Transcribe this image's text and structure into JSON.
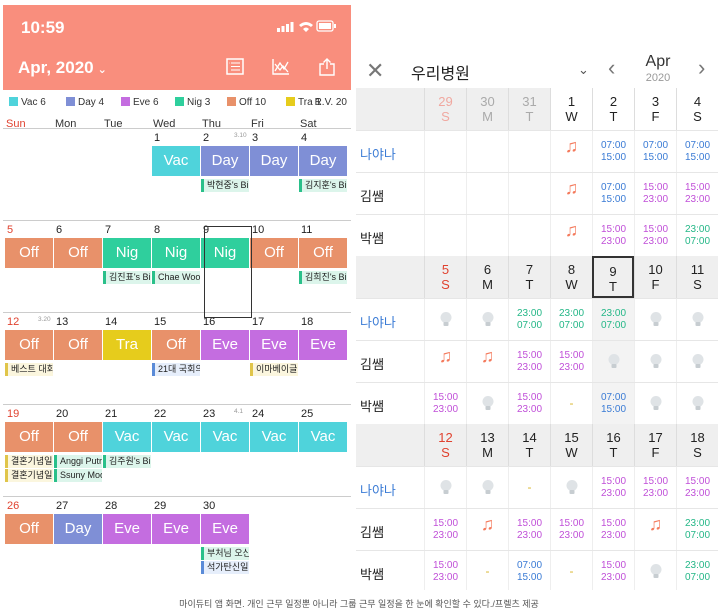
{
  "caption": "마이듀티 앱 화면. 개인 근무 일정뿐 아니라 그룹 근무 일정을 한 눈에 확인할 수 있다./프렐츠 제공",
  "colors": {
    "Vac": "#4fd3db",
    "Day": "#7f8fd6",
    "Eve": "#c46de0",
    "Nig": "#2fcf9d",
    "Off": "#e8916a",
    "Tra": "#e6cc1c",
    "header": "#f98e7d"
  },
  "left": {
    "status_time": "10:59",
    "status_icons": "●●●● ◢ ▭",
    "month_label": "Apr, 2020",
    "icons": [
      "list-icon",
      "chart-icon",
      "share-icon"
    ],
    "legend": [
      {
        "label": "Vac 6",
        "key": "Vac"
      },
      {
        "label": "Day 4",
        "key": "Day"
      },
      {
        "label": "Eve 6",
        "key": "Eve"
      },
      {
        "label": "Nig 3",
        "key": "Nig"
      },
      {
        "label": "Off 10",
        "key": "Off"
      },
      {
        "label": "Tra 1",
        "key": "Tra"
      }
    ],
    "version": "R.V. 20",
    "dows": [
      "Sun",
      "Mon",
      "Tue",
      "Wed",
      "Thu",
      "Fri",
      "Sat"
    ],
    "weeks": [
      {
        "days": [
          "",
          "",
          "",
          "1",
          "2",
          "3",
          "4"
        ],
        "shifts": [
          "",
          "",
          "",
          "Vac",
          "Day",
          "Day",
          "Day"
        ],
        "sub": {
          "4": "3.10"
        }
      },
      {
        "days": [
          "5",
          "6",
          "7",
          "8",
          "9",
          "10",
          "11"
        ],
        "shifts": [
          "Off",
          "Off",
          "Nig",
          "Nig",
          "Nig",
          "Off",
          "Off"
        ],
        "sub": {}
      },
      {
        "days": [
          "12",
          "13",
          "14",
          "15",
          "16",
          "17",
          "18"
        ],
        "shifts": [
          "Off",
          "Off",
          "Tra",
          "Off",
          "Eve",
          "Eve",
          "Eve"
        ],
        "sub": {
          "0": "3.20"
        }
      },
      {
        "days": [
          "19",
          "20",
          "21",
          "22",
          "23",
          "24",
          "25"
        ],
        "shifts": [
          "Off",
          "Off",
          "Vac",
          "Vac",
          "Vac",
          "Vac",
          "Vac"
        ],
        "sub": {
          "4": "4.1"
        }
      },
      {
        "days": [
          "26",
          "27",
          "28",
          "29",
          "30",
          "",
          ""
        ],
        "shifts": [
          "Off",
          "Day",
          "Eve",
          "Eve",
          "Eve",
          "",
          ""
        ],
        "sub": {}
      }
    ],
    "memos": [
      {
        "week": 0,
        "col": 4,
        "text": "박현중's Bir",
        "cls": "g"
      },
      {
        "week": 0,
        "col": 6,
        "text": "김지훈's Bir",
        "cls": "g"
      },
      {
        "week": 1,
        "col": 2,
        "text": "김진표's Bir",
        "cls": "g"
      },
      {
        "week": 1,
        "col": 3,
        "text": "Chae Woo",
        "cls": "g"
      },
      {
        "week": 1,
        "col": 6,
        "text": "김희진's Bir",
        "cls": "g"
      },
      {
        "week": 2,
        "col": 0,
        "text": "베스트 대회",
        "cls": "y"
      },
      {
        "week": 2,
        "col": 3,
        "text": "21대 국회의원",
        "cls": "b"
      },
      {
        "week": 2,
        "col": 5,
        "text": "이마베이글",
        "cls": "y"
      },
      {
        "week": 3,
        "col": 0,
        "text": "결혼기념일",
        "cls": "y"
      },
      {
        "week": 3,
        "col": 0,
        "text": "결혼기념일",
        "cls": "y",
        "line": 1
      },
      {
        "week": 3,
        "col": 1,
        "text": "Anggi Putri",
        "cls": "g"
      },
      {
        "week": 3,
        "col": 1,
        "text": "Ssuny Moo",
        "cls": "g",
        "line": 1
      },
      {
        "week": 3,
        "col": 2,
        "text": "김주원's Bir",
        "cls": "g"
      },
      {
        "week": 4,
        "col": 4,
        "text": "부처님 오신",
        "cls": "g"
      },
      {
        "week": 4,
        "col": 4,
        "text": "석가탄신일",
        "cls": "b",
        "line": 1
      }
    ]
  },
  "right": {
    "title": "우리병원",
    "month": "Apr",
    "year": "2020",
    "blocks": [
      {
        "dates": [
          {
            "n": "29",
            "d": "S",
            "cls": "gsun"
          },
          {
            "n": "30",
            "d": "M",
            "cls": "grey"
          },
          {
            "n": "31",
            "d": "T",
            "cls": "grey"
          },
          {
            "n": "1",
            "d": "W",
            "cls": "white"
          },
          {
            "n": "2",
            "d": "T",
            "cls": "white"
          },
          {
            "n": "3",
            "d": "F",
            "cls": "white"
          },
          {
            "n": "4",
            "d": "S",
            "cls": "white"
          }
        ],
        "rows": [
          {
            "name": "나야나",
            "me": true,
            "cells": [
              {
                "k": "empty"
              },
              {
                "k": "empty"
              },
              {
                "k": "empty"
              },
              {
                "k": "music"
              },
              {
                "k": "time",
                "c": "day",
                "t": "07:00\n15:00"
              },
              {
                "k": "time",
                "c": "day",
                "t": "07:00\n15:00"
              },
              {
                "k": "time",
                "c": "day",
                "t": "07:00\n15:00"
              }
            ]
          },
          {
            "name": "김쌤",
            "cells": [
              {
                "k": "empty"
              },
              {
                "k": "empty"
              },
              {
                "k": "empty"
              },
              {
                "k": "music"
              },
              {
                "k": "time",
                "c": "day",
                "t": "07:00\n15:00"
              },
              {
                "k": "time",
                "c": "eve",
                "t": "15:00\n23:00"
              },
              {
                "k": "time",
                "c": "eve",
                "t": "15:00\n23:00"
              }
            ]
          },
          {
            "name": "박쌤",
            "cells": [
              {
                "k": "empty"
              },
              {
                "k": "empty"
              },
              {
                "k": "empty"
              },
              {
                "k": "music"
              },
              {
                "k": "time",
                "c": "eve",
                "t": "15:00\n23:00"
              },
              {
                "k": "time",
                "c": "eve",
                "t": "15:00\n23:00"
              },
              {
                "k": "time",
                "c": "nig",
                "t": "23:00\n07:00"
              }
            ]
          }
        ]
      },
      {
        "dates": [
          {
            "n": "5",
            "d": "S",
            "cls": "sun"
          },
          {
            "n": "6",
            "d": "M",
            "cls": ""
          },
          {
            "n": "7",
            "d": "T",
            "cls": ""
          },
          {
            "n": "8",
            "d": "W",
            "cls": ""
          },
          {
            "n": "9",
            "d": "T",
            "cls": "sel"
          },
          {
            "n": "10",
            "d": "F",
            "cls": ""
          },
          {
            "n": "11",
            "d": "S",
            "cls": ""
          }
        ],
        "rows": [
          {
            "name": "나야나",
            "me": true,
            "cells": [
              {
                "k": "bulb"
              },
              {
                "k": "bulb"
              },
              {
                "k": "time",
                "c": "nig",
                "t": "23:00\n07:00"
              },
              {
                "k": "time",
                "c": "nig",
                "t": "23:00\n07:00"
              },
              {
                "k": "time",
                "c": "nig",
                "t": "23:00\n07:00",
                "hl": true
              },
              {
                "k": "bulb"
              },
              {
                "k": "bulb"
              }
            ]
          },
          {
            "name": "김쌤",
            "cells": [
              {
                "k": "music"
              },
              {
                "k": "music"
              },
              {
                "k": "time",
                "c": "eve",
                "t": "15:00\n23:00"
              },
              {
                "k": "time",
                "c": "eve",
                "t": "15:00\n23:00"
              },
              {
                "k": "bulb",
                "hl": true
              },
              {
                "k": "bulb"
              },
              {
                "k": "bulb"
              }
            ]
          },
          {
            "name": "박쌤",
            "cells": [
              {
                "k": "time",
                "c": "eve",
                "t": "15:00\n23:00"
              },
              {
                "k": "bulb"
              },
              {
                "k": "time",
                "c": "eve",
                "t": "15:00\n23:00"
              },
              {
                "k": "dash"
              },
              {
                "k": "time",
                "c": "day",
                "t": "07:00\n15:00",
                "hl": true
              },
              {
                "k": "bulb"
              },
              {
                "k": "bulb"
              }
            ]
          }
        ]
      },
      {
        "dates": [
          {
            "n": "12",
            "d": "S",
            "cls": "sun"
          },
          {
            "n": "13",
            "d": "M",
            "cls": ""
          },
          {
            "n": "14",
            "d": "T",
            "cls": ""
          },
          {
            "n": "15",
            "d": "W",
            "cls": ""
          },
          {
            "n": "16",
            "d": "T",
            "cls": ""
          },
          {
            "n": "17",
            "d": "F",
            "cls": ""
          },
          {
            "n": "18",
            "d": "S",
            "cls": ""
          }
        ],
        "rows": [
          {
            "name": "나야나",
            "me": true,
            "cells": [
              {
                "k": "bulb"
              },
              {
                "k": "bulb"
              },
              {
                "k": "dash"
              },
              {
                "k": "bulb"
              },
              {
                "k": "time",
                "c": "eve",
                "t": "15:00\n23:00"
              },
              {
                "k": "time",
                "c": "eve",
                "t": "15:00\n23:00"
              },
              {
                "k": "time",
                "c": "eve",
                "t": "15:00\n23:00"
              }
            ]
          },
          {
            "name": "김쌤",
            "cells": [
              {
                "k": "time",
                "c": "eve",
                "t": "15:00\n23:00"
              },
              {
                "k": "music"
              },
              {
                "k": "time",
                "c": "eve",
                "t": "15:00\n23:00"
              },
              {
                "k": "time",
                "c": "eve",
                "t": "15:00\n23:00"
              },
              {
                "k": "time",
                "c": "eve",
                "t": "15:00\n23:00"
              },
              {
                "k": "music"
              },
              {
                "k": "time",
                "c": "nig",
                "t": "23:00\n07:00"
              }
            ]
          },
          {
            "name": "박쌤",
            "cells": [
              {
                "k": "time",
                "c": "eve",
                "t": "15:00\n23:00"
              },
              {
                "k": "dash"
              },
              {
                "k": "time",
                "c": "day",
                "t": "07:00\n15:00"
              },
              {
                "k": "dash"
              },
              {
                "k": "time",
                "c": "eve",
                "t": "15:00\n23:00"
              },
              {
                "k": "bulb"
              },
              {
                "k": "time",
                "c": "nig",
                "t": "23:00\n07:00"
              }
            ]
          }
        ]
      }
    ]
  }
}
